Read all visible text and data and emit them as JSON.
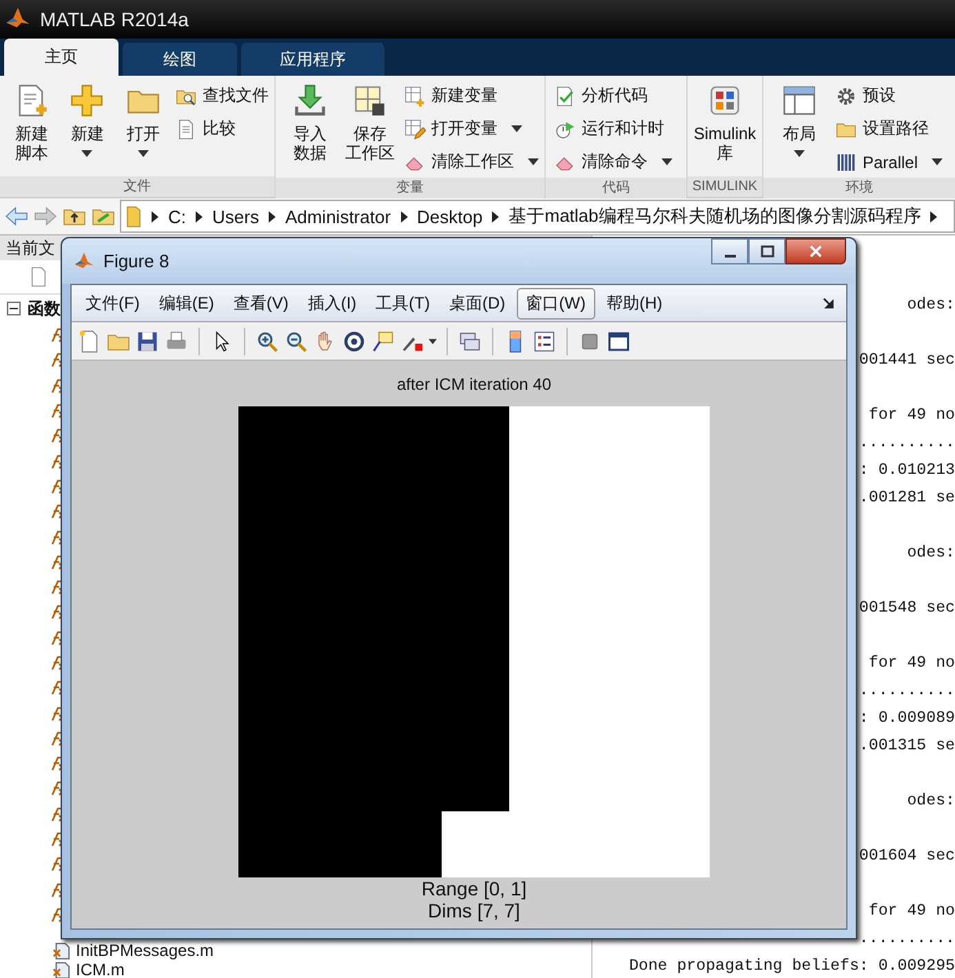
{
  "window": {
    "title": "MATLAB R2014a"
  },
  "tabs": [
    {
      "label": "主页",
      "selected": true
    },
    {
      "label": "绘图",
      "selected": false
    },
    {
      "label": "应用程序",
      "selected": false
    }
  ],
  "ribbon": {
    "groups": [
      {
        "label": "文件",
        "items": [
          {
            "kind": "large",
            "lines": [
              "新建",
              "脚本"
            ],
            "dropdown": false
          },
          {
            "kind": "large",
            "lines": [
              "新建"
            ],
            "dropdown": true
          },
          {
            "kind": "large",
            "lines": [
              "打开"
            ],
            "dropdown": true
          },
          {
            "kind": "stack",
            "items": [
              {
                "label": "查找文件",
                "dropdown": false
              },
              {
                "label": "比较",
                "dropdown": false
              }
            ]
          }
        ]
      },
      {
        "label": "变量",
        "items": [
          {
            "kind": "large",
            "lines": [
              "导入",
              "数据"
            ],
            "dropdown": false
          },
          {
            "kind": "large",
            "lines": [
              "保存",
              "工作区"
            ],
            "dropdown": false
          },
          {
            "kind": "stack",
            "items": [
              {
                "label": "新建变量",
                "dropdown": false
              },
              {
                "label": "打开变量",
                "dropdown": true
              },
              {
                "label": "清除工作区",
                "dropdown": true
              }
            ]
          }
        ]
      },
      {
        "label": "代码",
        "items": [
          {
            "kind": "stack",
            "items": [
              {
                "label": "分析代码",
                "dropdown": false
              },
              {
                "label": "运行和计时",
                "dropdown": false
              },
              {
                "label": "清除命令",
                "dropdown": true
              }
            ]
          }
        ]
      },
      {
        "label": "SIMULINK",
        "items": [
          {
            "kind": "large",
            "lines": [
              "Simulink",
              "库"
            ],
            "dropdown": false
          }
        ]
      },
      {
        "label": "环境",
        "items": [
          {
            "kind": "large",
            "lines": [
              "布局"
            ],
            "dropdown": true
          },
          {
            "kind": "stack",
            "items": [
              {
                "label": "预设",
                "dropdown": false
              },
              {
                "label": "设置路径",
                "dropdown": false
              },
              {
                "label": "Parallel",
                "dropdown": true
              }
            ]
          }
        ]
      }
    ]
  },
  "address_bar": {
    "crumbs": [
      "C:",
      "Users",
      "Administrator",
      "Desktop",
      "基于matlab编程马尔科夫随机场的图像分割源码程序"
    ]
  },
  "current_folder": {
    "title": "当前文",
    "group": {
      "label": "函数",
      "expanded": true
    },
    "files": [
      "InitBPMessages.m",
      "ICM.m"
    ]
  },
  "command_window": {
    "blocks": [
      [
        "odes:"
      ],
      [
        "001441 sec"
      ],
      [
        "for 49 no",
        "..........",
        ": 0.010213",
        ".001281 se"
      ],
      [
        "odes:"
      ],
      [
        "001548 sec"
      ],
      [
        "for 49 no",
        "..........",
        ": 0.009089",
        ".001315 se"
      ],
      [
        "odes:"
      ],
      [
        "001604 sec"
      ],
      [
        "for 49 no",
        "..........",
        "Done propagating beliefs: 0.009295"
      ]
    ]
  },
  "figure": {
    "title": "Figure 8",
    "menu": [
      {
        "label": "文件(F)",
        "selected": false
      },
      {
        "label": "编辑(E)",
        "selected": false
      },
      {
        "label": "查看(V)",
        "selected": false
      },
      {
        "label": "插入(I)",
        "selected": false
      },
      {
        "label": "工具(T)",
        "selected": false
      },
      {
        "label": "桌面(D)",
        "selected": false
      },
      {
        "label": "窗口(W)",
        "selected": true
      },
      {
        "label": "帮助(H)",
        "selected": false
      }
    ],
    "axes": {
      "title": "after ICM iteration 40",
      "cells": [
        [
          false,
          false,
          false,
          false,
          true,
          true,
          true
        ],
        [
          false,
          false,
          false,
          false,
          true,
          true,
          true
        ],
        [
          false,
          false,
          false,
          false,
          true,
          true,
          true
        ],
        [
          false,
          false,
          false,
          false,
          true,
          true,
          true
        ],
        [
          false,
          false,
          false,
          false,
          true,
          true,
          true
        ],
        [
          false,
          false,
          false,
          false,
          true,
          true,
          true
        ],
        [
          false,
          false,
          false,
          true,
          true,
          true,
          true
        ]
      ],
      "captions": [
        "Range [0, 1]",
        "Dims [7, 7]"
      ]
    }
  }
}
